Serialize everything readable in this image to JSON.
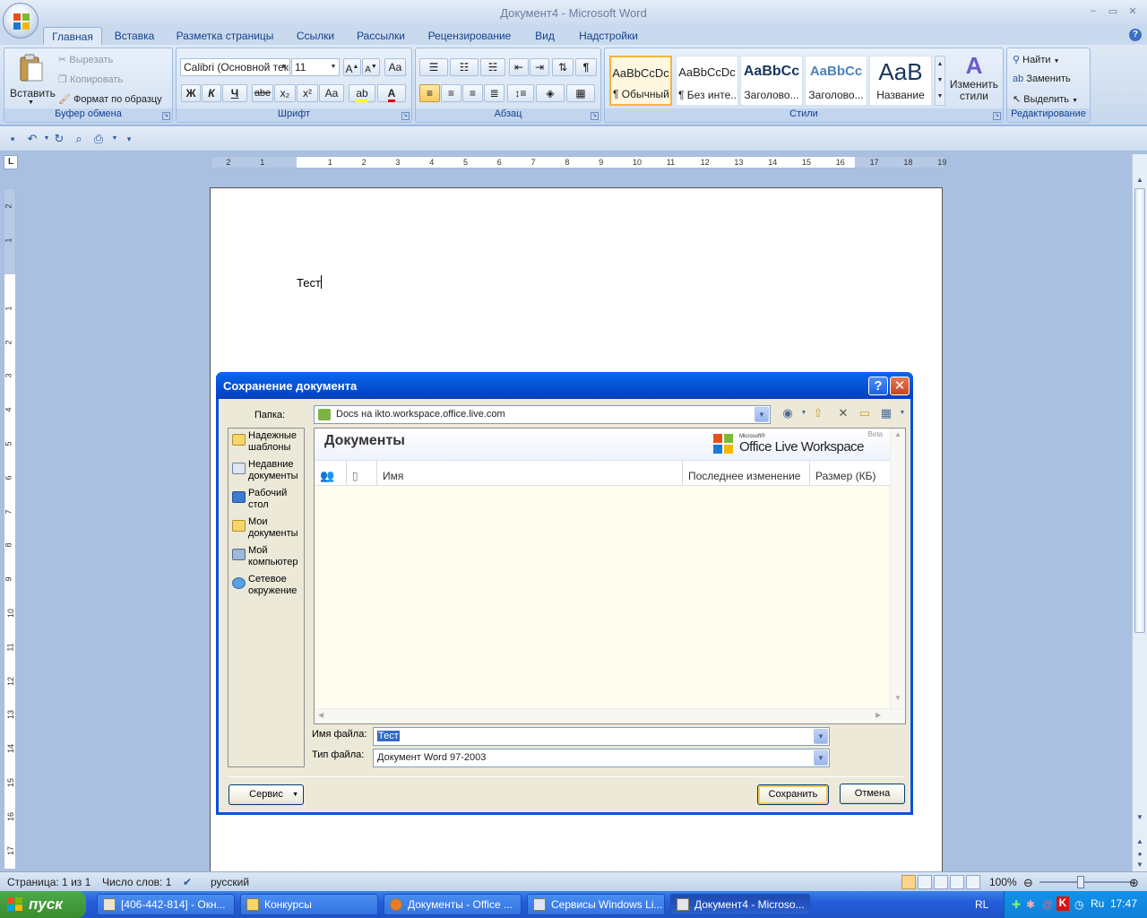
{
  "window": {
    "title": "Документ4 - Microsoft Word",
    "minimize": "–",
    "maximize": "▭",
    "close": "✕"
  },
  "ribbon": {
    "tabs": [
      "Главная",
      "Вставка",
      "Разметка страницы",
      "Ссылки",
      "Рассылки",
      "Рецензирование",
      "Вид",
      "Надстройки"
    ],
    "clipboard": {
      "label": "Буфер обмена",
      "paste": "Вставить",
      "cut": "Вырезать",
      "copy": "Копировать",
      "format_painter": "Формат по образцу"
    },
    "font": {
      "label": "Шрифт",
      "family": "Calibri (Основной текст)",
      "size": "11",
      "bold": "Ж",
      "italic": "К",
      "underline": "Ч",
      "strike": "abe",
      "subscript": "x₂",
      "superscript": "x²",
      "case": "Aa"
    },
    "paragraph": {
      "label": "Абзац",
      "pilcrow": "¶"
    },
    "styles": {
      "label": "Стили",
      "items": [
        {
          "sample": "AaBbCcDc",
          "name": "¶ Обычный"
        },
        {
          "sample": "AaBbCcDc",
          "name": "¶ Без инте..."
        },
        {
          "sample": "AaBbCc",
          "name": "Заголово..."
        },
        {
          "sample": "AaBbCc",
          "name": "Заголово..."
        },
        {
          "sample": "AaB",
          "name": "Название"
        }
      ],
      "change_styles": "Изменить стили"
    },
    "editing": {
      "label": "Редактирование",
      "find": "Найти",
      "replace": "Заменить",
      "select": "Выделить"
    }
  },
  "ruler": {
    "tab_selector": "L",
    "h_ticks": [
      "2",
      "1",
      "1",
      "2",
      "3",
      "4",
      "5",
      "6",
      "7",
      "8",
      "9",
      "10",
      "11",
      "12",
      "13",
      "14",
      "15",
      "16",
      "17",
      "18",
      "19"
    ],
    "v_ticks": [
      "2",
      "1",
      "1",
      "2",
      "3",
      "4",
      "5",
      "6",
      "7",
      "8",
      "9",
      "10",
      "11",
      "12",
      "13",
      "14",
      "15",
      "16",
      "17"
    ]
  },
  "document": {
    "text": "Тест"
  },
  "dialog": {
    "title": "Сохранение документа",
    "help": "?",
    "close": "✕",
    "folder_label": "Папка:",
    "folder_value": "Docs на ikto.workspace.office.live.com",
    "places": [
      {
        "label": "Надежные шаблоны",
        "icon": "folder-icon"
      },
      {
        "label": "Недавние документы",
        "icon": "recent-icon"
      },
      {
        "label": "Рабочий стол",
        "icon": "desktop-icon"
      },
      {
        "label": "Мои документы",
        "icon": "folder-icon"
      },
      {
        "label": "Мой компьютер",
        "icon": "computer-icon"
      },
      {
        "label": "Сетевое окружение",
        "icon": "network-icon"
      }
    ],
    "browser": {
      "heading": "Документы",
      "logo_microsoft": "Microsoft®",
      "logo_text": "Office Live Workspace",
      "logo_beta": "Beta",
      "columns": [
        "Имя",
        "Последнее изменение",
        "Размер (КБ)"
      ]
    },
    "filename_label": "Имя файла:",
    "filename_value": "Тест",
    "filetype_label": "Тип файла:",
    "filetype_value": "Документ Word 97-2003",
    "tools_button": "Сервис",
    "save_button": "Сохранить",
    "cancel_button": "Отмена"
  },
  "statusbar": {
    "page": "Страница: 1 из 1",
    "words": "Число слов: 1",
    "language": "русский",
    "zoom": "100%"
  },
  "taskbar": {
    "start": "пуск",
    "tasks": [
      {
        "label": "[406-442-814] - Окн...",
        "active": false
      },
      {
        "label": "Конкурсы",
        "active": false
      },
      {
        "label": "Документы - Office ...",
        "active": false
      },
      {
        "label": "Сервисы Windows Li...",
        "active": false
      },
      {
        "label": "Документ4 - Microso...",
        "active": true
      }
    ],
    "lang": "RL",
    "tray_lang": "Ru",
    "clock": "17:47"
  },
  "colors": {
    "ribbon_text": "#15428b",
    "xp_title": "#0453d4",
    "taskbar": "#245ddb",
    "start": "#3a8c2d"
  }
}
